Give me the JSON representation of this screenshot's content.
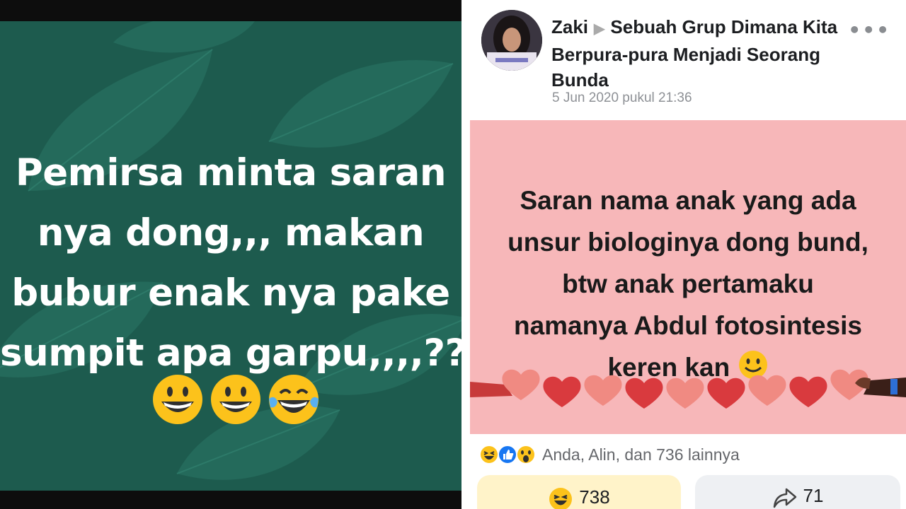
{
  "left_post": {
    "lines": [
      "Pemirsa minta saran",
      "nya dong,,, makan",
      "bubur enak nya pake",
      "sumpit apa garpu,,,,??"
    ],
    "emojis": [
      "grinning-face-icon",
      "grinning-face-icon",
      "tears-of-joy-icon"
    ],
    "background_color": "#1d5b4e"
  },
  "right_post": {
    "author": "Zaki",
    "group": "Sebuah Grup Dimana Kita Berpura-pura Menjadi Seorang Bunda",
    "timestamp": "5 Jun 2020 pukul 21:36",
    "more_label": "•••",
    "card": {
      "lines": [
        "Saran nama anak yang ada",
        "unsur biologinya dong bund,",
        "btw anak pertamaku",
        "namanya Abdul fotosintesis",
        "keren kan"
      ],
      "background_color": "#f7b7b9"
    },
    "reactions": {
      "icons": [
        "haha-icon",
        "like-icon",
        "wow-icon"
      ],
      "summary": "Anda, Alin, dan 736 lainnya"
    },
    "actions": {
      "react_count": "738",
      "share_count": "71"
    }
  }
}
